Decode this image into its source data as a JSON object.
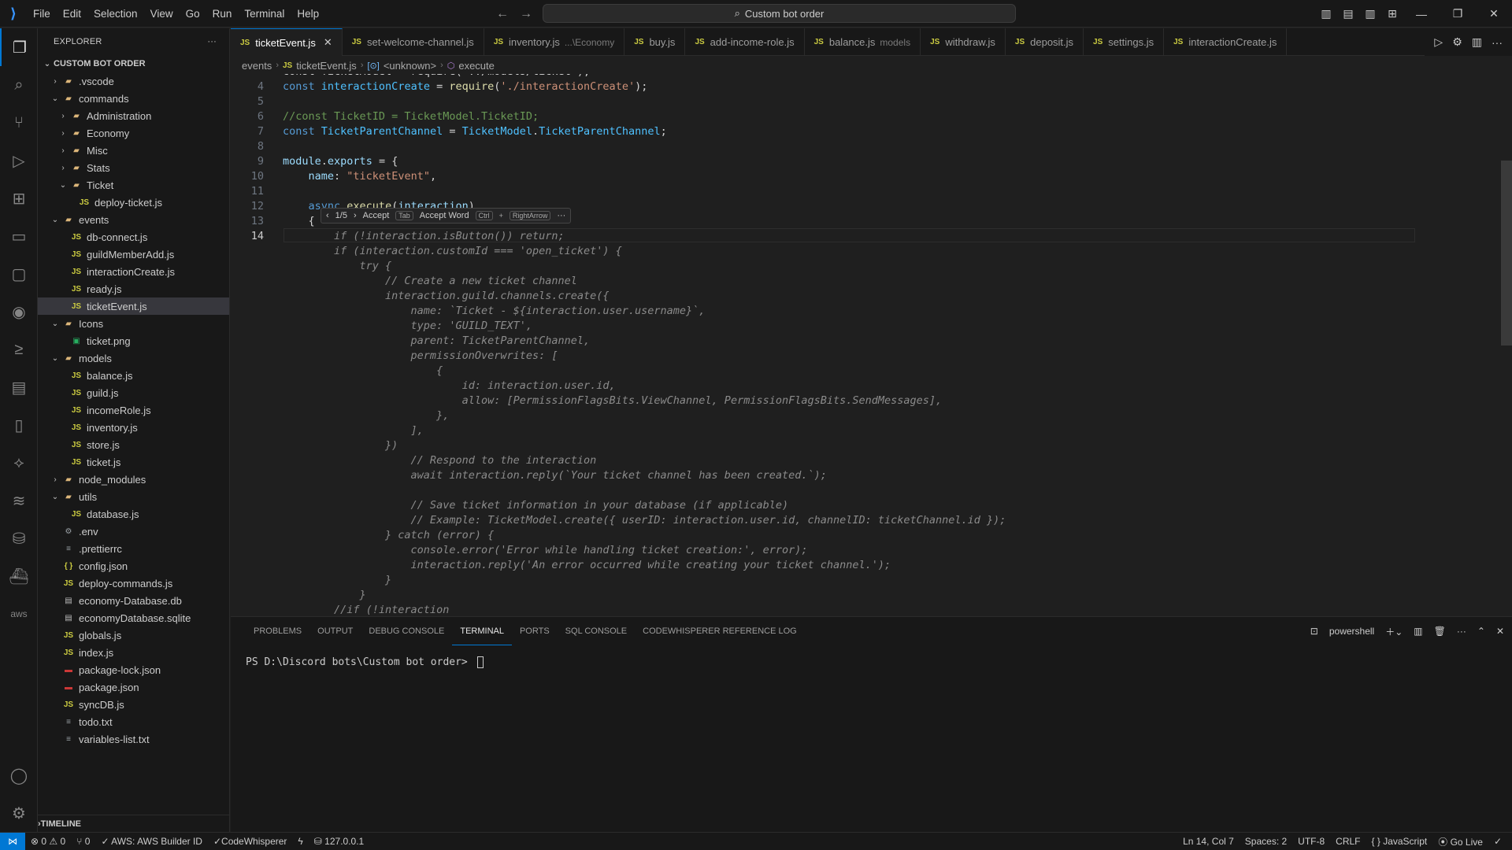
{
  "window": {
    "menu": [
      "File",
      "Edit",
      "Selection",
      "View",
      "Go",
      "Run",
      "Terminal",
      "Help"
    ],
    "search_text": "Custom bot order"
  },
  "sidebar": {
    "title": "EXPLORER",
    "root": "CUSTOM BOT ORDER",
    "timeline": "TIMELINE",
    "tree": [
      {
        "label": ".vscode",
        "kind": "folder",
        "depth": 1,
        "open": false
      },
      {
        "label": "commands",
        "kind": "folder",
        "depth": 1,
        "open": true
      },
      {
        "label": "Administration",
        "kind": "folder",
        "depth": 2,
        "open": false
      },
      {
        "label": "Economy",
        "kind": "folder",
        "depth": 2,
        "open": false
      },
      {
        "label": "Misc",
        "kind": "folder",
        "depth": 2,
        "open": false
      },
      {
        "label": "Stats",
        "kind": "folder",
        "depth": 2,
        "open": false
      },
      {
        "label": "Ticket",
        "kind": "folder",
        "depth": 2,
        "open": true
      },
      {
        "label": "deploy-ticket.js",
        "kind": "js",
        "depth": 3
      },
      {
        "label": "events",
        "kind": "folder",
        "depth": 1,
        "open": true
      },
      {
        "label": "db-connect.js",
        "kind": "js",
        "depth": 2
      },
      {
        "label": "guildMemberAdd.js",
        "kind": "js",
        "depth": 2
      },
      {
        "label": "interactionCreate.js",
        "kind": "js",
        "depth": 2
      },
      {
        "label": "ready.js",
        "kind": "js",
        "depth": 2
      },
      {
        "label": "ticketEvent.js",
        "kind": "js",
        "depth": 2,
        "selected": true
      },
      {
        "label": "Icons",
        "kind": "folder",
        "depth": 1,
        "open": true
      },
      {
        "label": "ticket.png",
        "kind": "img",
        "depth": 2
      },
      {
        "label": "models",
        "kind": "folder",
        "depth": 1,
        "open": true
      },
      {
        "label": "balance.js",
        "kind": "js",
        "depth": 2
      },
      {
        "label": "guild.js",
        "kind": "js",
        "depth": 2
      },
      {
        "label": "incomeRole.js",
        "kind": "js",
        "depth": 2
      },
      {
        "label": "inventory.js",
        "kind": "js",
        "depth": 2
      },
      {
        "label": "store.js",
        "kind": "js",
        "depth": 2
      },
      {
        "label": "ticket.js",
        "kind": "js",
        "depth": 2
      },
      {
        "label": "node_modules",
        "kind": "folder",
        "depth": 1,
        "open": false
      },
      {
        "label": "utils",
        "kind": "folder",
        "depth": 1,
        "open": true
      },
      {
        "label": "database.js",
        "kind": "js",
        "depth": 2
      },
      {
        "label": ".env",
        "kind": "env",
        "depth": 1
      },
      {
        "label": ".prettierrc",
        "kind": "txt",
        "depth": 1
      },
      {
        "label": "config.json",
        "kind": "json",
        "depth": 1
      },
      {
        "label": "deploy-commands.js",
        "kind": "js",
        "depth": 1
      },
      {
        "label": "economy-Database.db",
        "kind": "db",
        "depth": 1
      },
      {
        "label": "economyDatabase.sqlite",
        "kind": "db",
        "depth": 1
      },
      {
        "label": "globals.js",
        "kind": "js",
        "depth": 1
      },
      {
        "label": "index.js",
        "kind": "js",
        "depth": 1
      },
      {
        "label": "package-lock.json",
        "kind": "npm",
        "depth": 1
      },
      {
        "label": "package.json",
        "kind": "npm",
        "depth": 1
      },
      {
        "label": "syncDB.js",
        "kind": "js",
        "depth": 1
      },
      {
        "label": "todo.txt",
        "kind": "txt",
        "depth": 1
      },
      {
        "label": "variables-list.txt",
        "kind": "txt",
        "depth": 1
      }
    ]
  },
  "tabs": [
    {
      "label": "ticketEvent.js",
      "active": true,
      "desc": ""
    },
    {
      "label": "set-welcome-channel.js",
      "desc": ""
    },
    {
      "label": "inventory.js",
      "desc": "...\\Economy"
    },
    {
      "label": "buy.js",
      "desc": ""
    },
    {
      "label": "add-income-role.js",
      "desc": ""
    },
    {
      "label": "balance.js",
      "desc": "models"
    },
    {
      "label": "withdraw.js",
      "desc": ""
    },
    {
      "label": "deposit.js",
      "desc": ""
    },
    {
      "label": "settings.js",
      "desc": ""
    },
    {
      "label": "interactionCreate.js",
      "desc": ""
    }
  ],
  "breadcrumb": [
    "events",
    "ticketEvent.js",
    "<unknown>",
    "execute"
  ],
  "suggestion": {
    "counter": "1/5",
    "accept": "Accept",
    "accept_key": "Tab",
    "accept_word": "Accept Word",
    "accept_word_key1": "Ctrl",
    "accept_word_key2": "RightArrow"
  },
  "code": [
    {
      "n": "",
      "t": [
        [
          "pl",
          "const TicketModel = require('../models/ticket');"
        ]
      ]
    },
    {
      "n": "4",
      "t": [
        [
          "kw",
          "const "
        ],
        [
          "var",
          "interactionCreate"
        ],
        [
          "pl",
          " = "
        ],
        [
          "fn",
          "require"
        ],
        [
          "pl",
          "("
        ],
        [
          "str",
          "'./interactionCreate'"
        ],
        [
          "pl",
          ");"
        ]
      ]
    },
    {
      "n": "5",
      "t": []
    },
    {
      "n": "6",
      "t": [
        [
          "cmt",
          "//const TicketID = TicketModel.TicketID;"
        ]
      ]
    },
    {
      "n": "7",
      "t": [
        [
          "kw",
          "const "
        ],
        [
          "var",
          "TicketParentChannel"
        ],
        [
          "pl",
          " = "
        ],
        [
          "var",
          "TicketModel"
        ],
        [
          "pl",
          "."
        ],
        [
          "var",
          "TicketParentChannel"
        ],
        [
          "pl",
          ";"
        ]
      ]
    },
    {
      "n": "8",
      "t": []
    },
    {
      "n": "9",
      "t": [
        [
          "prop",
          "module"
        ],
        [
          "pl",
          "."
        ],
        [
          "prop",
          "exports"
        ],
        [
          "pl",
          " = {"
        ]
      ]
    },
    {
      "n": "10",
      "t": [
        [
          "pl",
          "    "
        ],
        [
          "prop",
          "name"
        ],
        [
          "pl",
          ": "
        ],
        [
          "str",
          "\"ticketEvent\""
        ],
        [
          "pl",
          ","
        ]
      ]
    },
    {
      "n": "11",
      "t": []
    },
    {
      "n": "12",
      "t": [
        [
          "pl",
          "    "
        ],
        [
          "kw",
          "async "
        ],
        [
          "fn",
          "execute"
        ],
        [
          "pl",
          "("
        ],
        [
          "prop",
          "interaction"
        ],
        [
          "pl",
          ")"
        ]
      ]
    },
    {
      "n": "13",
      "t": [
        [
          "pl",
          "    {"
        ]
      ]
    },
    {
      "n": "14",
      "cur": true,
      "t": [
        [
          "ghost",
          "        if (!interaction.isButton()) return;"
        ]
      ]
    },
    {
      "n": "",
      "t": [
        [
          "ghost",
          "        if (interaction.customId === 'open_ticket') {"
        ]
      ]
    },
    {
      "n": "",
      "t": [
        [
          "ghost",
          "            try {"
        ]
      ]
    },
    {
      "n": "",
      "t": [
        [
          "ghost",
          "                // Create a new ticket channel"
        ]
      ]
    },
    {
      "n": "",
      "t": [
        [
          "ghost",
          "                interaction.guild.channels.create({"
        ]
      ]
    },
    {
      "n": "",
      "t": [
        [
          "ghost",
          "                    name: `Ticket - ${interaction.user.username}`,"
        ]
      ]
    },
    {
      "n": "",
      "t": [
        [
          "ghost",
          "                    type: 'GUILD_TEXT',"
        ]
      ]
    },
    {
      "n": "",
      "t": [
        [
          "ghost",
          "                    parent: TicketParentChannel,"
        ]
      ]
    },
    {
      "n": "",
      "t": [
        [
          "ghost",
          "                    permissionOverwrites: ["
        ]
      ]
    },
    {
      "n": "",
      "t": [
        [
          "ghost",
          "                        {"
        ]
      ]
    },
    {
      "n": "",
      "t": [
        [
          "ghost",
          "                            id: interaction.user.id,"
        ]
      ]
    },
    {
      "n": "",
      "t": [
        [
          "ghost",
          "                            allow: [PermissionFlagsBits.ViewChannel, PermissionFlagsBits.SendMessages],"
        ]
      ]
    },
    {
      "n": "",
      "t": [
        [
          "ghost",
          "                        },"
        ]
      ]
    },
    {
      "n": "",
      "t": [
        [
          "ghost",
          "                    ],"
        ]
      ]
    },
    {
      "n": "",
      "t": [
        [
          "ghost",
          "                })"
        ]
      ]
    },
    {
      "n": "",
      "t": [
        [
          "ghost",
          "                    // Respond to the interaction"
        ]
      ]
    },
    {
      "n": "",
      "t": [
        [
          "ghost",
          "                    await interaction.reply(`Your ticket channel has been created.`);"
        ]
      ]
    },
    {
      "n": "",
      "t": []
    },
    {
      "n": "",
      "t": [
        [
          "ghost",
          "                    // Save ticket information in your database (if applicable)"
        ]
      ]
    },
    {
      "n": "",
      "t": [
        [
          "ghost",
          "                    // Example: TicketModel.create({ userID: interaction.user.id, channelID: ticketChannel.id });"
        ]
      ]
    },
    {
      "n": "",
      "t": [
        [
          "ghost",
          "                } catch (error) {"
        ]
      ]
    },
    {
      "n": "",
      "t": [
        [
          "ghost",
          "                    console.error('Error while handling ticket creation:', error);"
        ]
      ]
    },
    {
      "n": "",
      "t": [
        [
          "ghost",
          "                    interaction.reply('An error occurred while creating your ticket channel.');"
        ]
      ]
    },
    {
      "n": "",
      "t": [
        [
          "ghost",
          "                }"
        ]
      ]
    },
    {
      "n": "",
      "t": [
        [
          "ghost",
          "            }"
        ]
      ]
    },
    {
      "n": "",
      "t": [
        [
          "ghost",
          "        //if (!interaction"
        ]
      ]
    }
  ],
  "panel": {
    "tabs": [
      "PROBLEMS",
      "OUTPUT",
      "DEBUG CONSOLE",
      "TERMINAL",
      "PORTS",
      "SQL CONSOLE",
      "CODEWHISPERER REFERENCE LOG"
    ],
    "active_tab": "TERMINAL",
    "shell": "powershell",
    "prompt": "PS D:\\Discord bots\\Custom bot order> "
  },
  "status": {
    "errors": "0",
    "warnings": "0",
    "ports": "0",
    "aws": "AWS: AWS Builder ID",
    "codewhisperer": "CodeWhisperer",
    "host": "127.0.0.1",
    "position": "Ln 14, Col 7",
    "spaces": "Spaces: 2",
    "encoding": "UTF-8",
    "eol": "CRLF",
    "language": "JavaScript",
    "golive": "Go Live"
  },
  "colors": {
    "accent": "#0078d4",
    "js_icon": "#cbcb41"
  }
}
